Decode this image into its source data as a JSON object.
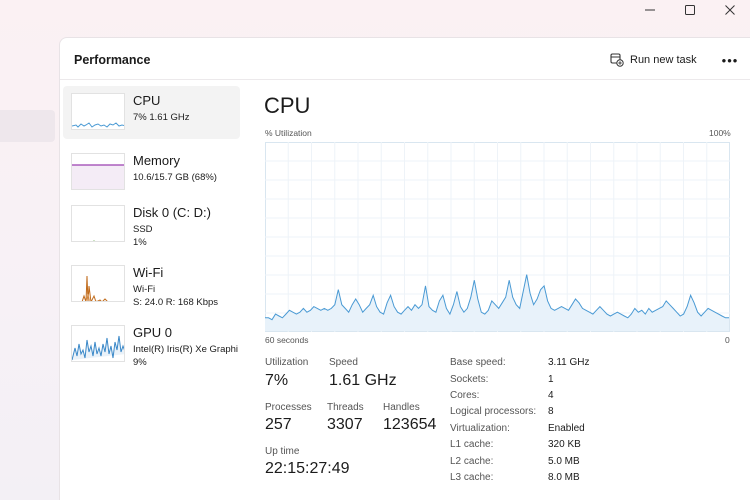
{
  "header": {
    "title": "Performance",
    "run_task_label": "Run new task",
    "more_label": "•••"
  },
  "sidebar": {
    "items": [
      {
        "name": "CPU",
        "line1": "7%  1.61 GHz",
        "line2": ""
      },
      {
        "name": "Memory",
        "line1": "10.6/15.7 GB (68%)",
        "line2": ""
      },
      {
        "name": "Disk 0 (C: D:)",
        "line1": "SSD",
        "line2": "1%"
      },
      {
        "name": "Wi-Fi",
        "line1": "Wi-Fi",
        "line2": "S: 24.0  R: 168 Kbps"
      },
      {
        "name": "GPU 0",
        "line1": "Intel(R) Iris(R) Xe Graphi",
        "line2": "9%"
      }
    ]
  },
  "detail": {
    "title": "CPU",
    "y_axis_label": "% Utilization",
    "y_max_label": "100%",
    "x_left_label": "60 seconds",
    "x_right_label": "0",
    "stats": {
      "utilization_label": "Utilization",
      "utilization_value": "7%",
      "speed_label": "Speed",
      "speed_value": "1.61 GHz",
      "processes_label": "Processes",
      "processes_value": "257",
      "threads_label": "Threads",
      "threads_value": "3307",
      "handles_label": "Handles",
      "handles_value": "123654",
      "uptime_label": "Up time",
      "uptime_value": "22:15:27:49"
    },
    "specs": [
      {
        "label": "Base speed:",
        "value": "3.11 GHz"
      },
      {
        "label": "Sockets:",
        "value": "1"
      },
      {
        "label": "Cores:",
        "value": "4"
      },
      {
        "label": "Logical processors:",
        "value": "8"
      },
      {
        "label": "Virtualization:",
        "value": "Enabled"
      },
      {
        "label": "L1 cache:",
        "value": "320 KB"
      },
      {
        "label": "L2 cache:",
        "value": "5.0 MB"
      },
      {
        "label": "L3 cache:",
        "value": "8.0 MB"
      }
    ]
  },
  "colors": {
    "cpu_line": "#4a9ad4",
    "cpu_fill": "#e8f2fa",
    "memory_line": "#9a3fb0",
    "disk_line": "#4c9a2a",
    "wifi_line": "#c06a1a",
    "gpu_line": "#3a88c8"
  },
  "chart_data": {
    "type": "area",
    "series": [
      {
        "values": [
          7,
          7,
          6,
          9,
          8,
          7,
          9,
          11,
          10,
          9,
          10,
          12,
          10,
          11,
          13,
          12,
          11,
          12,
          11,
          12,
          14,
          22,
          14,
          12,
          10,
          14,
          17,
          14,
          10,
          12,
          14,
          19,
          13,
          10,
          9,
          15,
          19,
          13,
          10,
          9,
          11,
          13,
          11,
          14,
          12,
          14,
          24,
          13,
          11,
          10,
          16,
          19,
          12,
          9,
          14,
          21,
          13,
          10,
          12,
          18,
          27,
          17,
          10,
          9,
          11,
          16,
          14,
          12,
          15,
          18,
          27,
          18,
          14,
          12,
          21,
          30,
          20,
          14,
          17,
          22,
          24,
          16,
          12,
          11,
          12,
          13,
          12,
          11,
          14,
          17,
          15,
          12,
          11,
          10,
          9,
          11,
          13,
          11,
          9,
          8,
          9,
          10,
          9,
          8,
          7,
          9,
          12,
          10,
          11,
          9,
          12,
          10,
          11,
          12,
          13,
          16,
          14,
          12,
          10,
          8,
          9,
          13,
          19,
          15,
          10,
          8,
          10,
          12,
          11,
          10,
          9,
          8,
          7,
          7
        ]
      }
    ],
    "ylim": [
      0,
      100
    ]
  }
}
